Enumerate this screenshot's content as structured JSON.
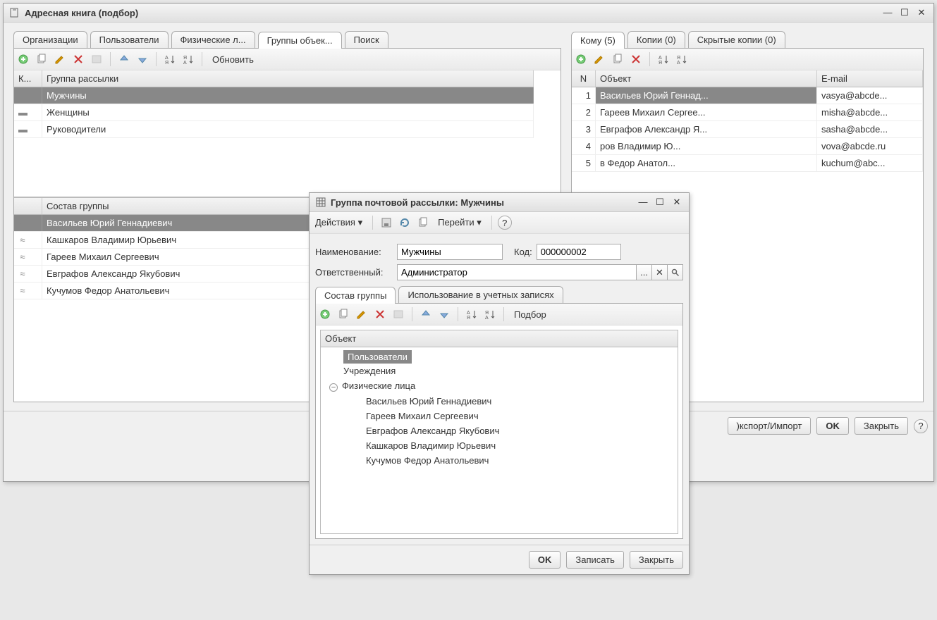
{
  "main": {
    "title": "Адресная книга (подбор)",
    "tabs_left": [
      {
        "label": "Организации",
        "active": false
      },
      {
        "label": "Пользователи",
        "active": false
      },
      {
        "label": "Физические л...",
        "active": false
      },
      {
        "label": "Группы объек...",
        "active": true
      },
      {
        "label": "Поиск",
        "active": false
      }
    ],
    "tabs_right": [
      {
        "label": "Кому (5)",
        "active": true
      },
      {
        "label": "Копии (0)",
        "active": false
      },
      {
        "label": "Скрытые копии (0)",
        "active": false
      }
    ],
    "toolbar_left": {
      "refresh": "Обновить"
    },
    "groups_grid": {
      "col_k": "К...",
      "col_name": "Группа рассылки",
      "rows": [
        {
          "k": "–",
          "name": "Мужчины",
          "selected": true
        },
        {
          "k": "–",
          "name": "Женщины",
          "selected": false
        },
        {
          "k": "–",
          "name": "Руководители",
          "selected": false
        }
      ]
    },
    "members_grid": {
      "col_name": "Состав группы",
      "rows": [
        {
          "name": "Васильев Юрий Геннадиевич",
          "selected": true
        },
        {
          "name": "Кашкаров Владимир Юрьевич",
          "selected": false
        },
        {
          "name": "Гареев Михаил Сергеевич",
          "selected": false
        },
        {
          "name": "Евграфов Александр Якубович",
          "selected": false
        },
        {
          "name": "Кучумов Федор Анатольевич",
          "selected": false
        }
      ]
    },
    "midbtns": {
      "one": ">",
      "all": ">>"
    },
    "recipients_grid": {
      "col_n": "N",
      "col_obj": "Объект",
      "col_email": "E-mail",
      "rows": [
        {
          "n": "1",
          "obj": "Васильев Юрий Геннад...",
          "email": "vasya@abcde...",
          "selected": true
        },
        {
          "n": "2",
          "obj": "Гареев Михаил Сергее...",
          "email": "misha@abcde...",
          "selected": false
        },
        {
          "n": "3",
          "obj": "Евграфов Александр Я...",
          "email": "sasha@abcde...",
          "selected": false
        },
        {
          "n": "4",
          "obj": "ров Владимир Ю...",
          "email": "vova@abcde.ru",
          "selected": false
        },
        {
          "n": "5",
          "obj": "в Федор Анатол...",
          "email": "kuchum@abc...",
          "selected": false
        }
      ]
    },
    "bottom": {
      "export": ")кспорт/Импорт",
      "ok": "OK",
      "close": "Закрыть"
    }
  },
  "dialog": {
    "title": "Группа почтовой рассылки: Мужчины",
    "toolbar": {
      "actions": "Действия ▾",
      "goto": "Перейти ▾"
    },
    "fields": {
      "name_label": "Наименование:",
      "name_value": "Мужчины",
      "code_label": "Код:",
      "code_value": "000000002",
      "resp_label": "Ответственный:",
      "resp_value": "Администратор"
    },
    "tabs": [
      {
        "label": "Состав группы",
        "active": true
      },
      {
        "label": "Использование в учетных записях",
        "active": false
      }
    ],
    "inner_toolbar": {
      "pick": "Подбор"
    },
    "tree": {
      "header": "Объект",
      "nodes": [
        {
          "label": "Пользователи",
          "level": 1,
          "selected": true
        },
        {
          "label": "Учреждения",
          "level": 1
        },
        {
          "label": "Физические лица",
          "level": 1,
          "expander": "⊖"
        },
        {
          "label": "Васильев Юрий Геннадиевич",
          "level": 2
        },
        {
          "label": "Гареев Михаил Сергеевич",
          "level": 2
        },
        {
          "label": "Евграфов Александр Якубович",
          "level": 2
        },
        {
          "label": "Кашкаров Владимир Юрьевич",
          "level": 2
        },
        {
          "label": "Кучумов Федор Анатольевич",
          "level": 2
        }
      ]
    },
    "bottom": {
      "ok": "OK",
      "save": "Записать",
      "close": "Закрыть"
    }
  },
  "icons": {
    "add": "+",
    "copy": "⎘",
    "edit": "✎",
    "delete": "✕",
    "list": "≡",
    "up": "▲",
    "down": "▼",
    "sortaz": "A↓",
    "sortza": "Я↓",
    "help": "?",
    "search": "🔍",
    "clear": "✕",
    "choose": "...",
    "bars": "☰",
    "refresh": "⟳"
  }
}
